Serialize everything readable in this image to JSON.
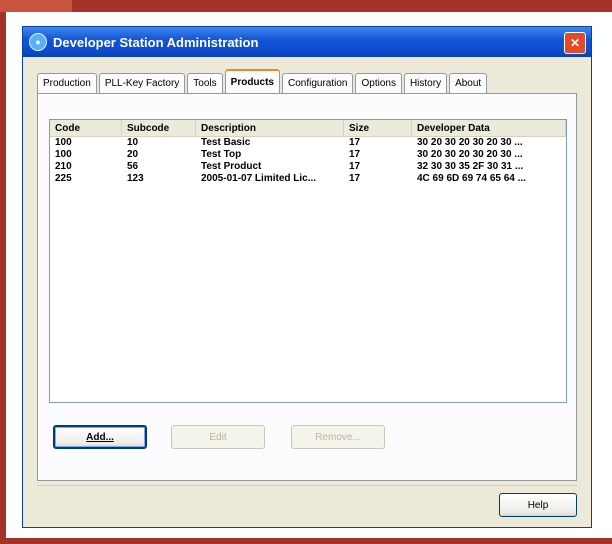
{
  "window": {
    "title": "Developer Station Administration",
    "close_glyph": "✕",
    "icon": "app-globe-icon"
  },
  "tabs": [
    {
      "label": "Production",
      "active": false
    },
    {
      "label": "PLL-Key Factory",
      "active": false
    },
    {
      "label": "Tools",
      "active": false
    },
    {
      "label": "Products",
      "active": true
    },
    {
      "label": "Configuration",
      "active": false
    },
    {
      "label": "Options",
      "active": false
    },
    {
      "label": "History",
      "active": false
    },
    {
      "label": "About",
      "active": false
    }
  ],
  "table": {
    "columns": [
      "Code",
      "Subcode",
      "Description",
      "Size",
      "Developer Data"
    ],
    "rows": [
      [
        "100",
        "10",
        "Test Basic",
        "17",
        "30 20 30 20 30 20 30 ..."
      ],
      [
        "100",
        "20",
        "Test Top",
        "17",
        "30 20 30 20 30 20 30 ..."
      ],
      [
        "210",
        "56",
        "Test Product",
        "17",
        "32 30 30 35 2F 30 31 ..."
      ],
      [
        "225",
        "123",
        "2005-01-07 Limited Lic...",
        "17",
        "4C 69 6D 69 74 65 64 ..."
      ]
    ]
  },
  "buttons": {
    "add": "Add...",
    "edit": "Edit",
    "remove": "Remove...",
    "help": "Help"
  },
  "colors": {
    "frame": "#a3322a",
    "titlebar": "#0b49c8",
    "active_tab_accent": "#e68b2c"
  }
}
